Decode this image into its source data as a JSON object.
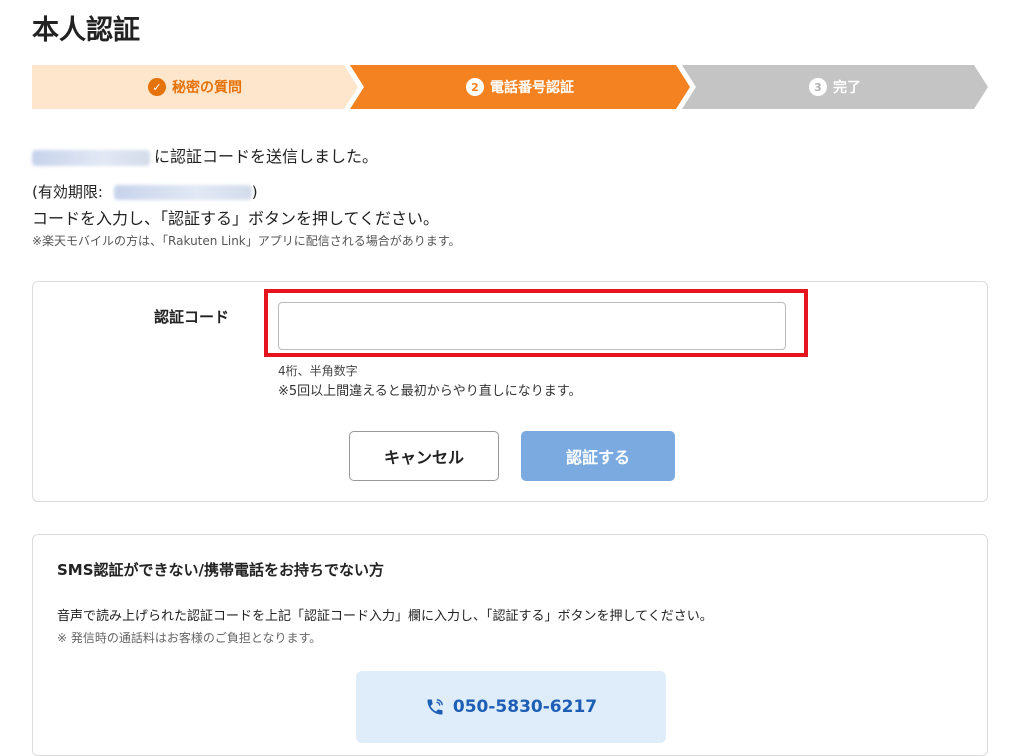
{
  "page": {
    "title": "本人認証"
  },
  "stepper": {
    "steps": [
      {
        "num": "✓",
        "label": "秘密の質問",
        "state": "done"
      },
      {
        "num": "2",
        "label": "電話番号認証",
        "state": "current"
      },
      {
        "num": "3",
        "label": "完了",
        "state": "pending"
      }
    ],
    "colors": {
      "done_bg": "#fde6cc",
      "current_bg": "#f58220",
      "pending_bg": "#c4c4c4"
    }
  },
  "message": {
    "sent_suffix": "に認証コードを送信しました。",
    "expiry_prefix": "(有効期限:",
    "expiry_suffix": ")",
    "instruction": "コードを入力し、「認証する」ボタンを押してください。",
    "note": "※楽天モバイルの方は、「Rakuten Link」アプリに配信される場合があります。"
  },
  "form": {
    "code_label": "認証コード",
    "code_value": "",
    "code_placeholder": "",
    "hint_format": "4桁、半角数字",
    "hint_retry": "※5回以上間違えると最初からやり直しになります。",
    "cancel_label": "キャンセル",
    "verify_label": "認証する"
  },
  "sms_section": {
    "title": "SMS認証ができない/携帯電話をお持ちでない方",
    "description": "音声で読み上げられた認証コードを上記「認証コード入力」欄に入力し、「認証する」ボタンを押してください。",
    "note": "※ 発信時の通話料はお客様のご負担となります。",
    "phone_number": "050-5830-6217",
    "phone_icon": "phone-icon"
  }
}
